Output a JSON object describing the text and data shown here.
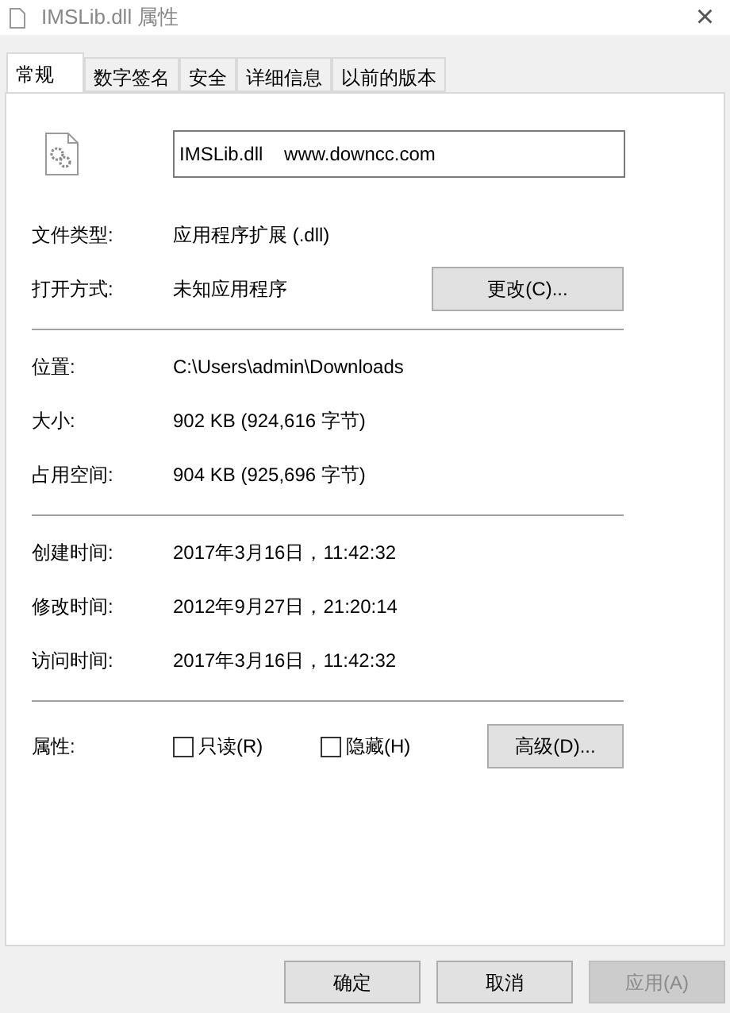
{
  "window": {
    "title": "IMSLib.dll 属性",
    "close": "×"
  },
  "tabs": [
    {
      "label": "常规",
      "selected": true
    },
    {
      "label": "数字签名",
      "selected": false
    },
    {
      "label": "安全",
      "selected": false
    },
    {
      "label": "详细信息",
      "selected": false
    },
    {
      "label": "以前的版本",
      "selected": false
    }
  ],
  "file_name": "IMSLib.dll    www.downcc.com",
  "sections": [
    [
      {
        "label": "文件类型:",
        "value": "应用程序扩展 (.dll)"
      },
      {
        "label": "打开方式:",
        "value": "未知应用程序",
        "button": "更改(C)..."
      }
    ],
    [
      {
        "label": "位置:",
        "value": "C:\\Users\\admin\\Downloads"
      },
      {
        "label": "大小:",
        "value": "902 KB (924,616 字节)"
      },
      {
        "label": "占用空间:",
        "value": "904 KB (925,696 字节)"
      }
    ],
    [
      {
        "label": "创建时间:",
        "value": "2017年3月16日，11:42:32"
      },
      {
        "label": "修改时间:",
        "value": "2012年9月27日，21:20:14"
      },
      {
        "label": "访问时间:",
        "value": "2017年3月16日，11:42:32"
      }
    ]
  ],
  "attributes": {
    "label": "属性:",
    "checkboxes": [
      {
        "label": "只读(R)",
        "checked": false
      },
      {
        "label": "隐藏(H)",
        "checked": false
      }
    ],
    "button": "高级(D)..."
  },
  "buttons": [
    {
      "label": "确定",
      "disabled": false
    },
    {
      "label": "取消",
      "disabled": false
    },
    {
      "label": "应用(A)",
      "disabled": true
    }
  ]
}
